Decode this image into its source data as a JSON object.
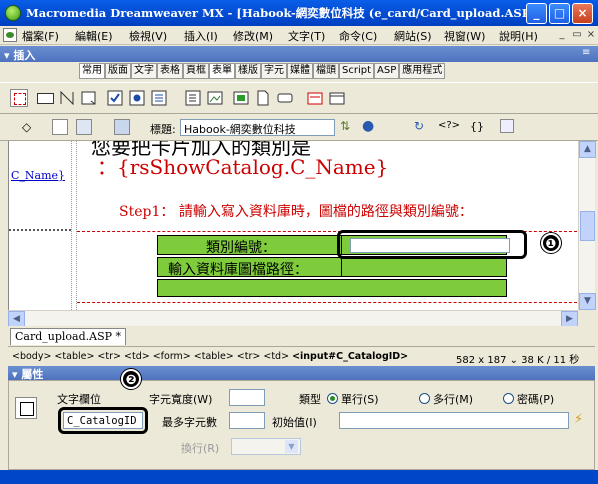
{
  "window": {
    "title": "Macromedia Dreamweaver MX - [Habook-網奕數位科技 (e_card/Card_upload.ASP*)]",
    "controls": [
      "_",
      "□",
      "×"
    ]
  },
  "menu": {
    "items": [
      "檔案(F)",
      "編輯(E)",
      "檢視(V)",
      "插入(I)",
      "修改(M)",
      "文字(T)",
      "命令(C)",
      "網站(S)",
      "視窗(W)",
      "說明(H)"
    ],
    "mdi_controls": [
      "_",
      "▭",
      "×"
    ]
  },
  "insert_bar": {
    "title": "▾ 插入",
    "tabs": [
      "常用",
      "版面",
      "文字",
      "表格",
      "頁框",
      "表單",
      "樣版",
      "字元",
      "媒體",
      "檔頭",
      "Script",
      "ASP",
      "應用程式"
    ],
    "icon_names": [
      "form-icon",
      "textfield-icon",
      "hidden-field-icon",
      "textarea-icon",
      "checkbox-icon",
      "radio-icon",
      "radio-group-icon",
      "list-menu-icon",
      "jump-menu-icon",
      "image-field-icon",
      "file-field-icon",
      "button-icon",
      "label-icon",
      "fieldset-icon"
    ]
  },
  "doc_toolbar": {
    "title_label": "標題:",
    "title_value": "Habook-網奕數位科技",
    "icon_names": [
      "code-view-icon",
      "split-view-icon",
      "design-view-icon",
      "live-data-icon",
      "file-management-icon",
      "preview-icon",
      "refresh-icon",
      "reference-icon",
      "code-nav-icon",
      "view-options-icon"
    ]
  },
  "design": {
    "left_link": "C_Name}",
    "heading": "您要把卡片加入的類別是",
    "rs_field": "：{rsShowCatalog.C_Name}",
    "step_text": "Step1： 請輸入寫入資料庫時，圖檔的路徑與類別編號：",
    "row1_label": "類別編號：",
    "row2_label": "輸入資料庫圖檔路徑："
  },
  "doc_tab": {
    "label": "Card_upload.ASP *"
  },
  "status": {
    "tag_path_prefix": "<body> <table> <tr> <td> <form> <table> <tr> <td> ",
    "tag_path_selected": "<input#C_CatalogID>",
    "doc_size": "582 x 187 ⌄ 38 K / 11 秒"
  },
  "properties": {
    "title": "▾ 屬性",
    "textfield_label": "文字欄位",
    "name_value": "C_CatalogID",
    "char_width_label": "字元寬度(W)",
    "max_chars_label": "最多字元數",
    "type_label": "類型",
    "type_options": [
      "單行(S)",
      "多行(M)",
      "密碼(P)"
    ],
    "type_selected": "單行(S)",
    "init_value_label": "初始值(I)",
    "wrap_label": "換行(R)"
  },
  "callouts": {
    "badge1": "❶",
    "badge2": "❷"
  },
  "colors": {
    "titlebar": "#0450d8",
    "form_row_green": "#7ecb3c",
    "red_text": "#cc0000",
    "panel_header": "#5a7ec6"
  }
}
